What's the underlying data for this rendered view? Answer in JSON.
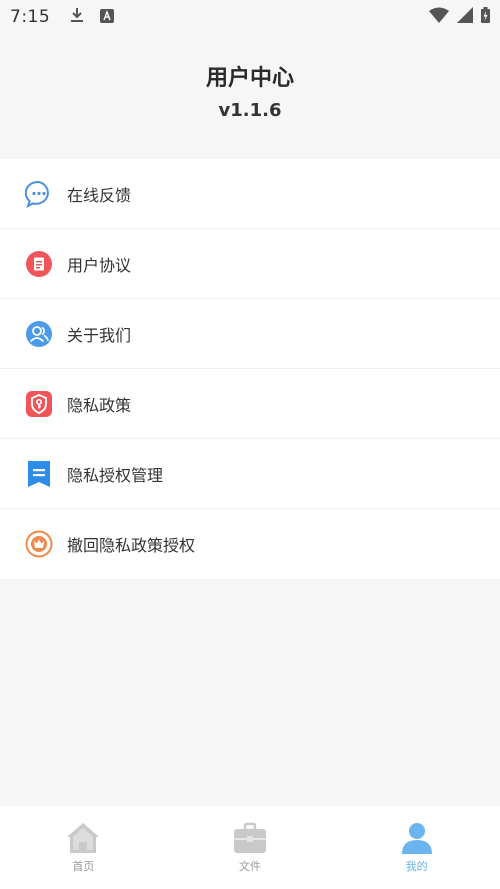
{
  "status_bar": {
    "time": "7:15",
    "icons": [
      "download-icon",
      "a-badge-icon",
      "wifi-icon",
      "signal-icon",
      "battery-icon"
    ]
  },
  "header": {
    "title": "用户中心",
    "version": "v1.1.6"
  },
  "menu": {
    "items": [
      {
        "label": "在线反馈",
        "icon": "feedback-icon",
        "color": "#4a90e2"
      },
      {
        "label": "用户协议",
        "icon": "agreement-icon",
        "color": "#f0555a"
      },
      {
        "label": "关于我们",
        "icon": "about-us-icon",
        "color": "#4b9be8"
      },
      {
        "label": "隐私政策",
        "icon": "privacy-policy-icon",
        "color": "#f0555a"
      },
      {
        "label": "隐私授权管理",
        "icon": "privacy-authorization-icon",
        "color": "#2d8ce8"
      },
      {
        "label": "撤回隐私政策授权",
        "icon": "revoke-authorization-icon",
        "color": "#f08a4b"
      }
    ]
  },
  "tab_bar": {
    "tabs": [
      {
        "label": "首页",
        "icon": "home-icon",
        "active": false
      },
      {
        "label": "文件",
        "icon": "briefcase-icon",
        "active": false
      },
      {
        "label": "我的",
        "icon": "profile-icon",
        "active": true
      }
    ],
    "active_color": "#6bb4ee",
    "inactive_color": "#c9c9c9"
  }
}
